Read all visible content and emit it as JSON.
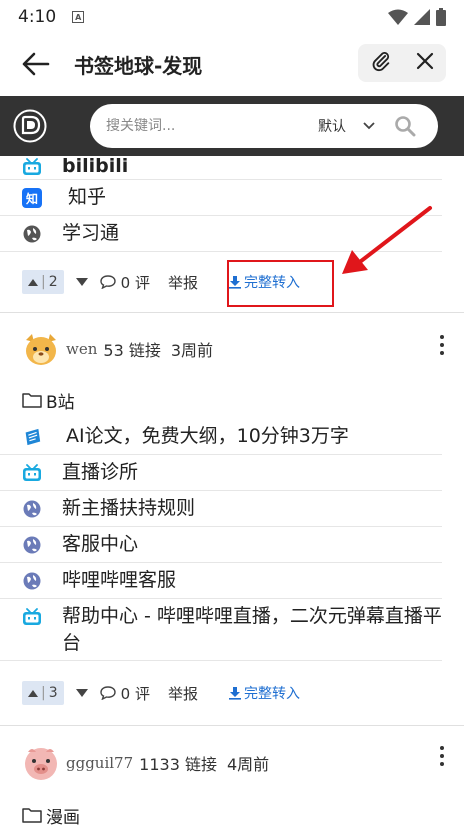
{
  "status": {
    "time": "4:10",
    "indicator": "A"
  },
  "appbar": {
    "title": "书签地球-发现",
    "back_icon": "arrow-left-icon",
    "attach_icon": "paperclip-icon",
    "close_icon": "close-icon"
  },
  "search": {
    "placeholder": "搜关键词...",
    "sort_value": "默认"
  },
  "first_post_tail": {
    "links": [
      {
        "icon": "bilibili-icon",
        "text": "bilibili"
      },
      {
        "icon": "zhihu-icon",
        "text": "知乎"
      },
      {
        "icon": "globe-icon",
        "text": "学习通"
      }
    ],
    "votes": "2",
    "comments": "0 评",
    "report": "举报",
    "import": "完整转入"
  },
  "post2": {
    "user": "wen",
    "count": "53 链接",
    "time": "3周前",
    "folder": "B站",
    "links": [
      {
        "icon": "paper-icon",
        "text": "AI论文，免费大纲，10分钟3万字"
      },
      {
        "icon": "bilibili-icon",
        "text": "直播诊所"
      },
      {
        "icon": "globe-icon",
        "text": "新主播扶持规则"
      },
      {
        "icon": "globe-icon",
        "text": "客服中心"
      },
      {
        "icon": "globe-icon",
        "text": "哔哩哔哩客服"
      },
      {
        "icon": "bilibili-icon",
        "text": "帮助中心 - 哔哩哔哩直播，二次元弹幕直播平台"
      }
    ],
    "votes": "3",
    "comments": "0 评",
    "report": "举报",
    "import": "完整转入"
  },
  "post3": {
    "user": "ggguil77",
    "count": "1133 链接",
    "time": "4周前",
    "folder": "漫画"
  },
  "colors": {
    "accent": "#1f6fd1",
    "annotation": "#e0161b",
    "searchbar": "#333333"
  }
}
